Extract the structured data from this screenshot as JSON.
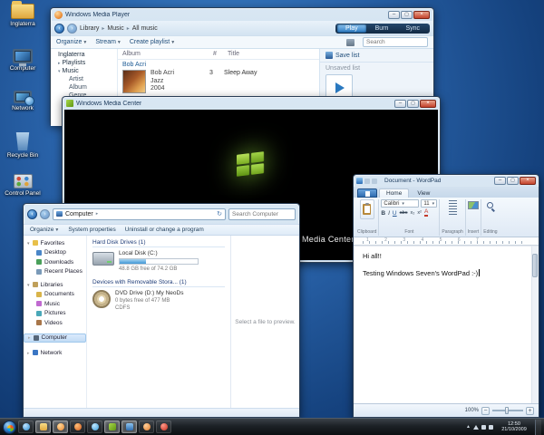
{
  "desktop": {
    "icons": [
      {
        "label": "Inglaterra"
      },
      {
        "label": "Computer"
      },
      {
        "label": "Network"
      },
      {
        "label": "Recycle Bin"
      },
      {
        "label": "Control Panel"
      }
    ]
  },
  "wmp": {
    "title": "Windows Media Player",
    "breadcrumb": {
      "library": "Library",
      "music": "Music",
      "all_music": "All music"
    },
    "tabs": {
      "play": "Play",
      "burn": "Burn",
      "sync": "Sync"
    },
    "toolbar": {
      "organize": "Organize",
      "stream": "Stream",
      "create_playlist": "Create playlist"
    },
    "search_placeholder": "Search",
    "nav": [
      {
        "label": "Inglaterra"
      },
      {
        "label": "Playlists"
      },
      {
        "label": "Music"
      },
      {
        "label": "Artist"
      },
      {
        "label": "Album"
      },
      {
        "label": "Genre"
      }
    ],
    "columns": {
      "album": "Album",
      "num": "#",
      "title": "Title"
    },
    "group_artist": "Bob Acri",
    "album": {
      "artist": "Bob Acri",
      "genre": "Jazz",
      "year": "2004"
    },
    "track": {
      "num": "3",
      "title": "Sleep Away"
    },
    "list_panel": {
      "save_list": "Save list",
      "unsaved_list": "Unsaved list"
    }
  },
  "media_center": {
    "title": "Windows Media Center",
    "caption": "Media Center"
  },
  "explorer": {
    "address": "Computer",
    "search_placeholder": "Search Computer",
    "toolbar": {
      "organize": "Organize",
      "system_properties": "System properties",
      "uninstall": "Uninstall or change a program"
    },
    "sidebar": [
      {
        "label": "Favorites"
      },
      {
        "label": "Desktop"
      },
      {
        "label": "Downloads"
      },
      {
        "label": "Recent Places"
      },
      {
        "label": "Libraries"
      },
      {
        "label": "Documents"
      },
      {
        "label": "Music"
      },
      {
        "label": "Pictures"
      },
      {
        "label": "Videos"
      },
      {
        "label": "Computer"
      },
      {
        "label": "Network"
      }
    ],
    "group_hdd": "Hard Disk Drives (1)",
    "group_removable": "Devices with Removable Stora... (1)",
    "drive_c": {
      "label": "Local Disk (C:)",
      "free": "48.8 GB free of 74.2 GB"
    },
    "drive_d": {
      "label": "DVD Drive (D:) My NeoDs",
      "free": "0 bytes free of 477 MB",
      "fs": "CDFS"
    },
    "preview": "Select a file to preview."
  },
  "wordpad": {
    "title": "Document - WordPad",
    "tabs": {
      "home": "Home",
      "view": "View"
    },
    "font": {
      "name": "Calibri",
      "size": "11"
    },
    "fmt": {
      "bold": "B",
      "italic": "I",
      "underline": "U",
      "strike": "abc",
      "sub": "x₂",
      "sup": "x²",
      "color": "A"
    },
    "groups": {
      "clipboard": "Clipboard",
      "font": "Font",
      "paragraph": "Paragraph",
      "insert": "Insert",
      "editing": "Editing"
    },
    "ruler_numbers": "1 2 3 4 5 6 7",
    "doc": {
      "line1": "Hi all!!",
      "line2": "Testing Windows Seven's WordPad :-)"
    },
    "zoom": "100%"
  },
  "taskbar": {
    "icons": [
      {
        "name": "internet-explorer"
      },
      {
        "name": "windows-explorer"
      },
      {
        "name": "windows-media-player"
      },
      {
        "name": "firefox"
      },
      {
        "name": "messenger"
      },
      {
        "name": "media-center"
      },
      {
        "name": "wordpad"
      },
      {
        "name": "firefox-2"
      },
      {
        "name": "opera"
      }
    ],
    "clock": {
      "time": "12:50",
      "date": "21/10/2009"
    }
  }
}
